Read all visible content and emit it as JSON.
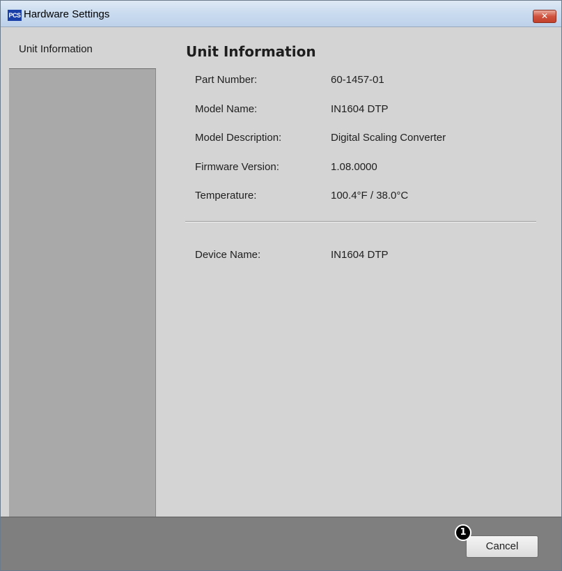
{
  "window": {
    "title": "Hardware Settings",
    "app_icon": "PCS",
    "close_glyph": "✕"
  },
  "sidebar": {
    "items": [
      {
        "label": "Unit Information",
        "selected": true
      }
    ]
  },
  "main": {
    "heading": "Unit Information",
    "info": [
      {
        "label": "Part Number:",
        "value": "60-1457-01"
      },
      {
        "label": "Model Name:",
        "value": "IN1604 DTP"
      },
      {
        "label": "Model Description:",
        "value": "Digital Scaling Converter"
      },
      {
        "label": "Firmware Version:",
        "value": "1.08.0000"
      },
      {
        "label": "Temperature:",
        "value": "100.4°F / 38.0°C"
      }
    ],
    "device": {
      "label": "Device Name:",
      "value": "IN1604 DTP"
    }
  },
  "footer": {
    "cancel_label": "Cancel",
    "callout_number": "1"
  },
  "colors": {
    "title_bar": "#c9dbef",
    "content_bg": "#d4d4d4",
    "sidebar_bg": "#a9a9a9",
    "footer_bg": "#7f7f7f",
    "close_button": "#d0533f",
    "app_icon_bg": "#1b3fa8"
  },
  "icons": {
    "app": "pcs-app-icon",
    "close": "close-icon",
    "callout": "callout-marker-icon"
  }
}
